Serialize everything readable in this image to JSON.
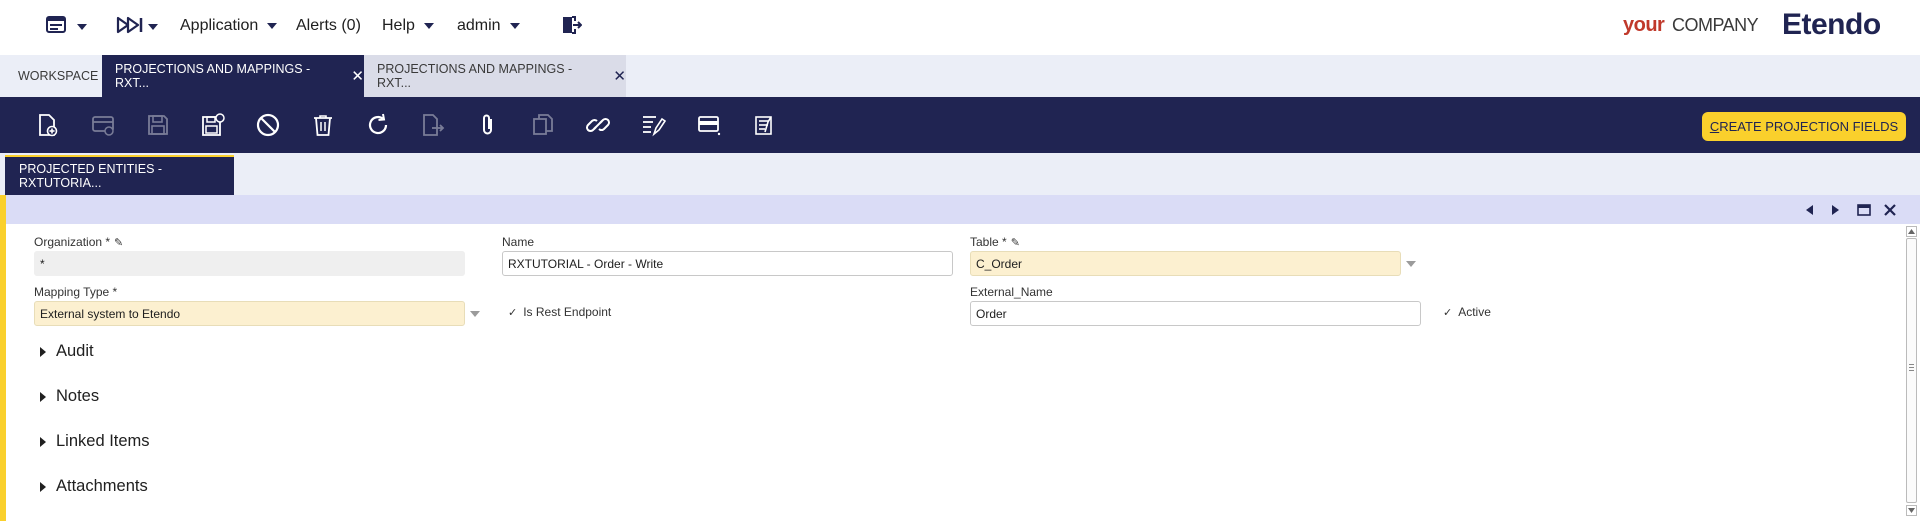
{
  "nav": {
    "application": "Application",
    "alerts": "Alerts (0)",
    "help": "Help",
    "user": "admin"
  },
  "brand": {
    "your": "your",
    "company": "COMPANY",
    "product": "Etendo"
  },
  "window_tabs": [
    {
      "label": "WORKSPACE",
      "active": false
    },
    {
      "label": "PROJECTIONS AND MAPPINGS - RXT...",
      "active": true
    },
    {
      "label": "PROJECTIONS AND MAPPINGS - RXT...",
      "active": false
    }
  ],
  "toolbar": {
    "icons": [
      "new-record-icon",
      "new-row-icon",
      "save-icon",
      "save-close-icon",
      "undo-icon",
      "delete-icon",
      "refresh-icon",
      "export-icon",
      "attachment-icon",
      "clone-icon",
      "link-icon",
      "audit-trail-icon",
      "grid-view-icon",
      "form-view-icon"
    ],
    "cta_label": "CREATE PROJECTION FIELDS",
    "cta_accent": "C"
  },
  "subtab": {
    "label": "PROJECTED ENTITIES - RXTUTORIA..."
  },
  "form": {
    "organization": {
      "label": "Organization *",
      "value": "*"
    },
    "name": {
      "label": "Name",
      "value": "RXTUTORIAL - Order - Write"
    },
    "table": {
      "label": "Table *",
      "value": "C_Order"
    },
    "mapping_type": {
      "label": "Mapping Type *",
      "value": "External system to Etendo"
    },
    "is_rest_endpoint": {
      "label": "Is Rest Endpoint",
      "checked": true
    },
    "external_name": {
      "label": "External_Name",
      "value": "Order"
    },
    "active": {
      "label": "Active",
      "checked": true
    }
  },
  "sections": [
    "Audit",
    "Notes",
    "Linked Items",
    "Attachments"
  ],
  "colors": {
    "navy": "#202452",
    "accent_yellow": "#fad02c",
    "tab_bg": "#ebeef7",
    "form_header": "#dadcf6",
    "required_field": "#fcf0d0"
  }
}
